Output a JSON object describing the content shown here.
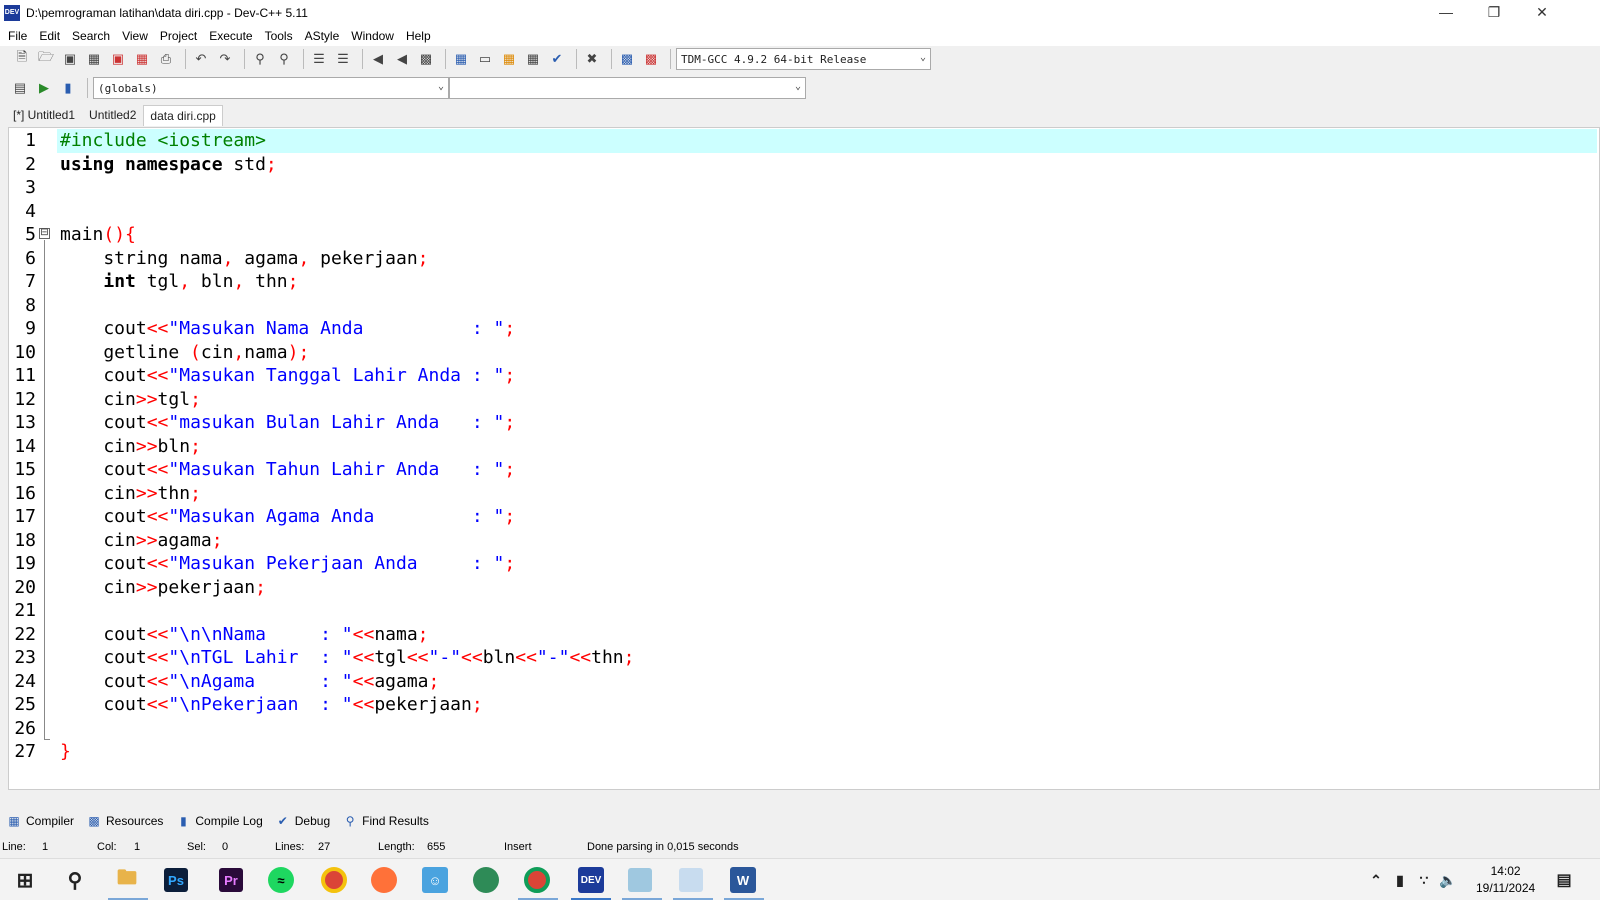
{
  "window": {
    "title": "D:\\pemrograman latihan\\data diri.cpp - Dev-C++ 5.11",
    "app_icon": "DEV",
    "controls": [
      "minimize-icon",
      "restore-icon",
      "close-icon"
    ]
  },
  "menu": [
    "File",
    "Edit",
    "Search",
    "View",
    "Project",
    "Execute",
    "Tools",
    "AStyle",
    "Window",
    "Help"
  ],
  "toolbar": {
    "compiler_select": "TDM-GCC 4.9.2 64-bit Release",
    "scope_select": "(globals)",
    "member_select": ""
  },
  "tabs": [
    "[*] Untitled1",
    "Untitled2",
    "data diri.cpp"
  ],
  "editor": {
    "line_numbers": [
      "1",
      "2",
      "3",
      "4",
      "5",
      "6",
      "7",
      "8",
      "9",
      "10",
      "11",
      "12",
      "13",
      "14",
      "15",
      "16",
      "17",
      "18",
      "19",
      "20",
      "21",
      "22",
      "23",
      "24",
      "25",
      "26",
      "27"
    ],
    "fold_marker": "⊟"
  },
  "bottom_tabs": [
    "Compiler",
    "Resources",
    "Compile Log",
    "Debug",
    "Find Results"
  ],
  "status": {
    "line_label": "Line:",
    "line": "1",
    "col_label": "Col:",
    "col": "1",
    "sel_label": "Sel:",
    "sel": "0",
    "lines_label": "Lines:",
    "lines": "27",
    "length_label": "Length:",
    "length": "655",
    "mode": "Insert",
    "message": "Done parsing in 0,015 seconds"
  },
  "taskbar": {
    "time": "14:02",
    "date": "19/11/2024",
    "apps": [
      "windows-start-icon",
      "search-icon",
      "file-explorer-icon",
      "photoshop-icon",
      "premiere-icon",
      "spotify-icon",
      "chrome-icon",
      "firefox-icon",
      "qq-icon",
      "earth-icon",
      "chrome-user-icon",
      "devcpp-icon",
      "notes-icon",
      "drive-icon",
      "word-icon"
    ],
    "app_labels": {
      "photoshop": "Ps",
      "premiere": "Pr",
      "devcpp": "DEV",
      "word": "W"
    }
  },
  "colors": {
    "current_line": "#ccffff",
    "keyword": "#000000",
    "string": "#0000ff",
    "symbol": "#ff0000",
    "preprocessor": "#008000"
  }
}
